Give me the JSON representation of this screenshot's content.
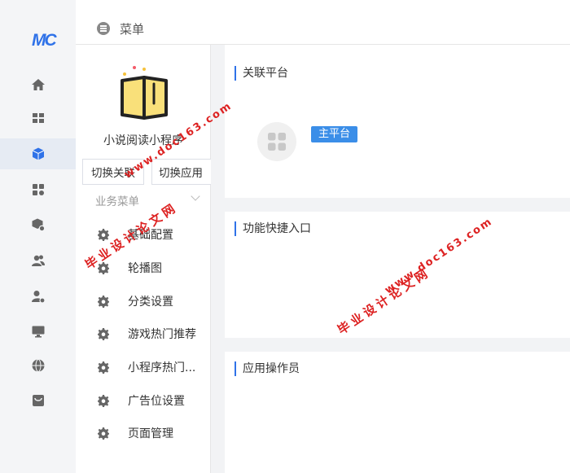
{
  "rail": {
    "logo": "MC",
    "items": [
      {
        "name": "home-icon"
      },
      {
        "name": "dashboard-icon"
      },
      {
        "name": "cube-icon",
        "active": true
      },
      {
        "name": "apps-icon"
      },
      {
        "name": "box-settings-icon"
      },
      {
        "name": "users-icon"
      },
      {
        "name": "user-settings-icon"
      },
      {
        "name": "monitor-icon"
      },
      {
        "name": "globe-icon"
      },
      {
        "name": "store-icon"
      }
    ]
  },
  "header": {
    "title": "菜单"
  },
  "subnav": {
    "app_name": "小说阅读小程序",
    "switch_link_label": "切换关联",
    "switch_app_label": "切换应用",
    "section_title": "业务菜单",
    "items": [
      {
        "label": "基础配置"
      },
      {
        "label": "轮播图"
      },
      {
        "label": "分类设置"
      },
      {
        "label": "游戏热门推荐"
      },
      {
        "label": "小程序热门..."
      },
      {
        "label": "广告位设置"
      },
      {
        "label": "页面管理"
      }
    ]
  },
  "main": {
    "linked_platform": {
      "title": "关联平台",
      "badge": "主平台"
    },
    "shortcuts": {
      "title": "功能快捷入口"
    },
    "operators": {
      "title": "应用操作员"
    }
  },
  "watermark": {
    "site": "www.doc163.com",
    "name": "毕业设计论文网"
  },
  "colors": {
    "accent": "#2f72e8",
    "badge": "#3b8ee8",
    "watermark": "#dd2222"
  }
}
